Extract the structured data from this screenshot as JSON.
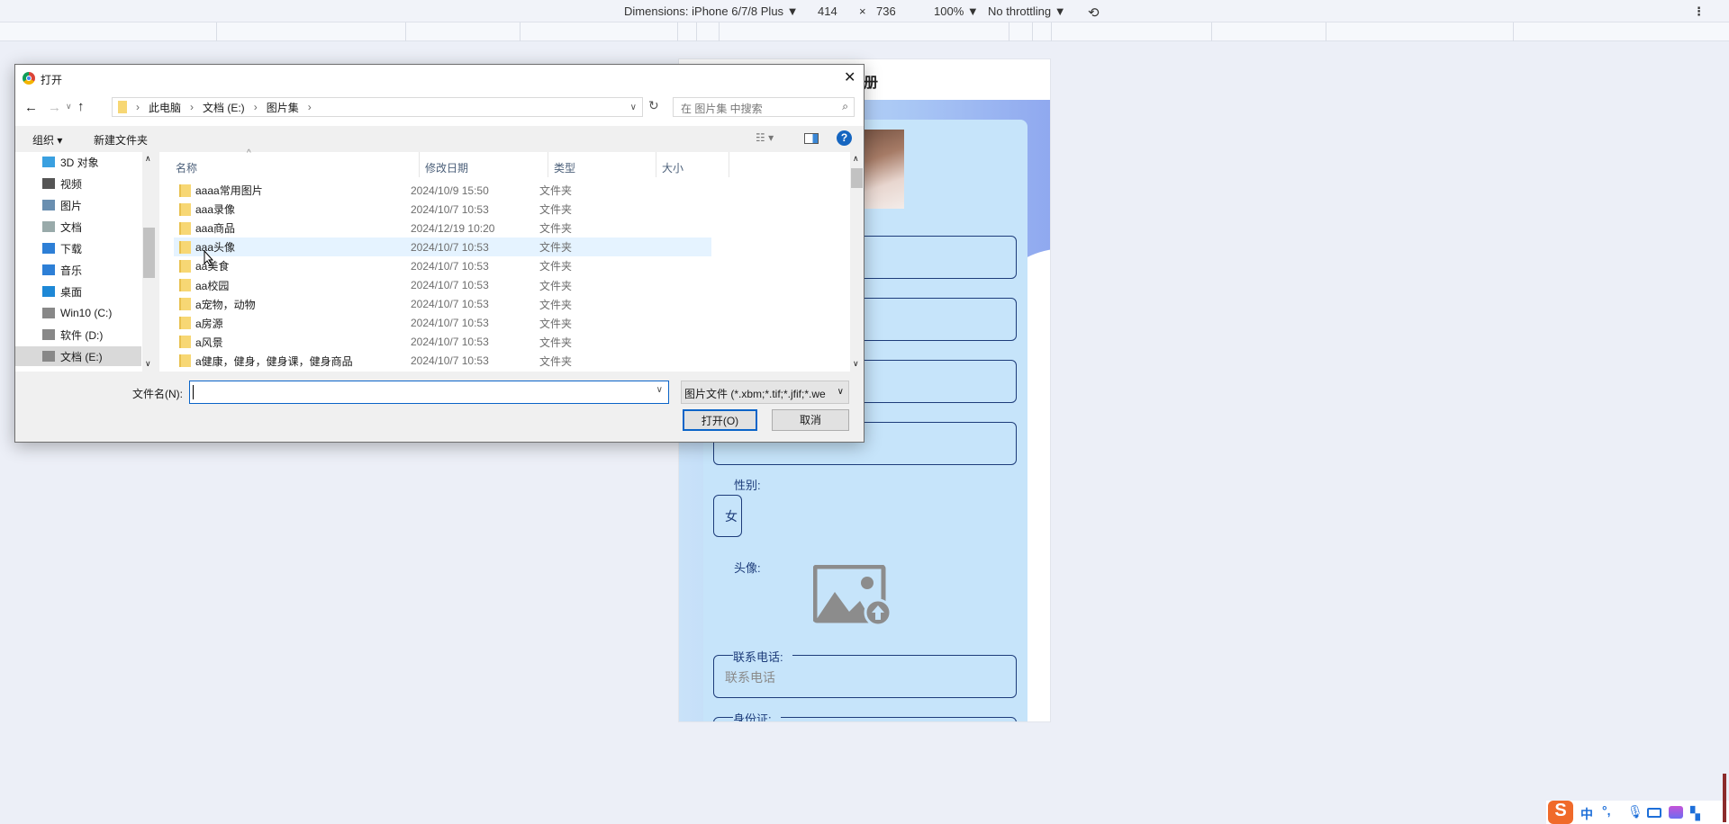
{
  "devtools": {
    "dimensions_label": "Dimensions: iPhone 6/7/8 Plus ▼",
    "width": "414",
    "times": "×",
    "height": "736",
    "zoom": "100% ▼",
    "throttling": "No throttling ▼",
    "more": "⋮"
  },
  "page": {
    "title_fragment": "册",
    "gender_label": "性别:",
    "gender_value": "女",
    "avatar_label": "头像:",
    "phone_label": "联系电话:",
    "phone_placeholder": "联系电话",
    "id_label": "身份证:",
    "password_dots": "•••"
  },
  "dialog": {
    "title": "打开",
    "close": "✕",
    "breadcrumb": [
      "此电脑",
      "文档 (E:)",
      "图片集"
    ],
    "search_placeholder": "在 图片集 中搜索",
    "organize": "组织 ▾",
    "new_folder": "新建文件夹",
    "nav": [
      {
        "label": "3D 对象",
        "color": "#3aa0e0"
      },
      {
        "label": "视频",
        "color": "#555"
      },
      {
        "label": "图片",
        "color": "#6a8fb0"
      },
      {
        "label": "文档",
        "color": "#9aa"
      },
      {
        "label": "下载",
        "color": "#2d7fd6"
      },
      {
        "label": "音乐",
        "color": "#2d7fd6"
      },
      {
        "label": "桌面",
        "color": "#1e88d6"
      },
      {
        "label": "Win10 (C:)",
        "color": "#888"
      },
      {
        "label": "软件 (D:)",
        "color": "#888"
      },
      {
        "label": "文档 (E:)",
        "color": "#888"
      }
    ],
    "columns": [
      "名称",
      "修改日期",
      "类型",
      "大小"
    ],
    "files": [
      {
        "name": "aaaa常用图片",
        "date": "2024/10/9 15:50",
        "type": "文件夹"
      },
      {
        "name": "aaa录像",
        "date": "2024/10/7 10:53",
        "type": "文件夹"
      },
      {
        "name": "aaa商品",
        "date": "2024/12/19 10:20",
        "type": "文件夹"
      },
      {
        "name": "aaa头像",
        "date": "2024/10/7 10:53",
        "type": "文件夹"
      },
      {
        "name": "aa美食",
        "date": "2024/10/7 10:53",
        "type": "文件夹"
      },
      {
        "name": "aa校园",
        "date": "2024/10/7 10:53",
        "type": "文件夹"
      },
      {
        "name": "a宠物，动物",
        "date": "2024/10/7 10:53",
        "type": "文件夹"
      },
      {
        "name": "a房源",
        "date": "2024/10/7 10:53",
        "type": "文件夹"
      },
      {
        "name": "a风景",
        "date": "2024/10/7 10:53",
        "type": "文件夹"
      },
      {
        "name": "a健康，健身，健身课，健身商品",
        "date": "2024/10/7 10:53",
        "type": "文件夹"
      }
    ],
    "filename_label": "文件名(N):",
    "filename_value": "",
    "filter": "图片文件 (*.xbm;*.tif;*.jfif;*.we",
    "open": "打开(O)",
    "cancel": "取消"
  },
  "ime": {
    "lang": "中",
    "punct": "°,"
  }
}
